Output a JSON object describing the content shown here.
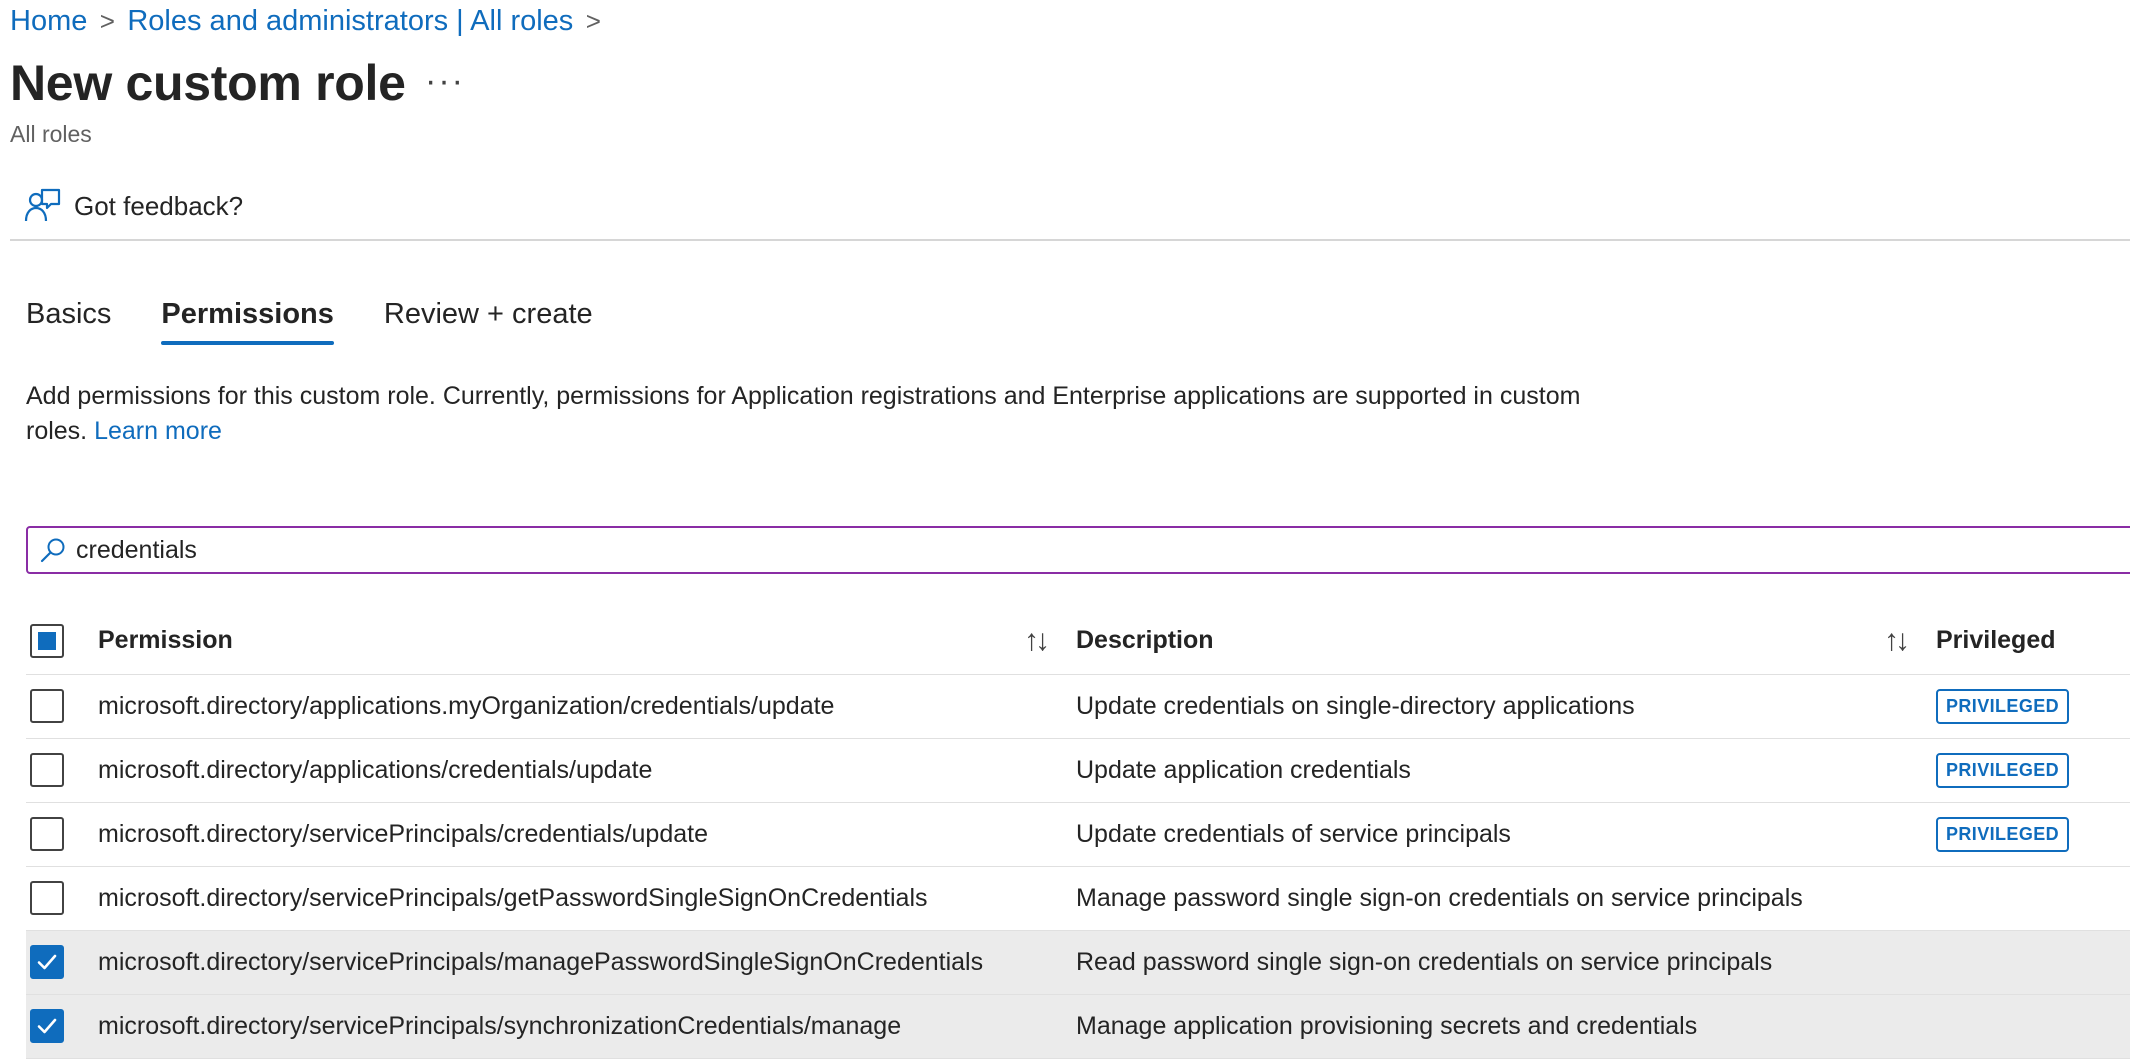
{
  "breadcrumb": {
    "home": "Home",
    "parent": "Roles and administrators | All roles",
    "separator": ">"
  },
  "header": {
    "title": "New custom role",
    "more": "···",
    "subtitle": "All roles"
  },
  "feedback": {
    "label": "Got feedback?"
  },
  "tabs": [
    {
      "label": "Basics",
      "active": false
    },
    {
      "label": "Permissions",
      "active": true
    },
    {
      "label": "Review + create",
      "active": false
    }
  ],
  "intro": {
    "text": "Add permissions for this custom role. Currently, permissions for Application registrations and Enterprise applications are supported in custom roles.",
    "link": "Learn more"
  },
  "search": {
    "value": "credentials",
    "placeholder": ""
  },
  "table": {
    "columns": {
      "permission": "Permission",
      "description": "Description",
      "privileged": "Privileged",
      "sort_icon": "↑↓"
    },
    "rows": [
      {
        "permission": "microsoft.directory/applications.myOrganization/credentials/update",
        "description": "Update credentials on single-directory applications",
        "privileged": "PRIVILEGED",
        "checked": false
      },
      {
        "permission": "microsoft.directory/applications/credentials/update",
        "description": "Update application credentials",
        "privileged": "PRIVILEGED",
        "checked": false
      },
      {
        "permission": "microsoft.directory/servicePrincipals/credentials/update",
        "description": "Update credentials of service principals",
        "privileged": "PRIVILEGED",
        "checked": false
      },
      {
        "permission": "microsoft.directory/servicePrincipals/getPasswordSingleSignOnCredentials",
        "description": "Manage password single sign-on credentials on service principals",
        "privileged": "",
        "checked": false
      },
      {
        "permission": "microsoft.directory/servicePrincipals/managePasswordSingleSignOnCredentials",
        "description": "Read password single sign-on credentials on service principals",
        "privileged": "",
        "checked": true
      },
      {
        "permission": "microsoft.directory/servicePrincipals/synchronizationCredentials/manage",
        "description": "Manage application provisioning secrets and credentials",
        "privileged": "",
        "checked": true
      }
    ]
  },
  "colors": {
    "accent": "#0f6cbd",
    "search_border": "#8a2da5",
    "selected_row": "#ebebeb"
  }
}
